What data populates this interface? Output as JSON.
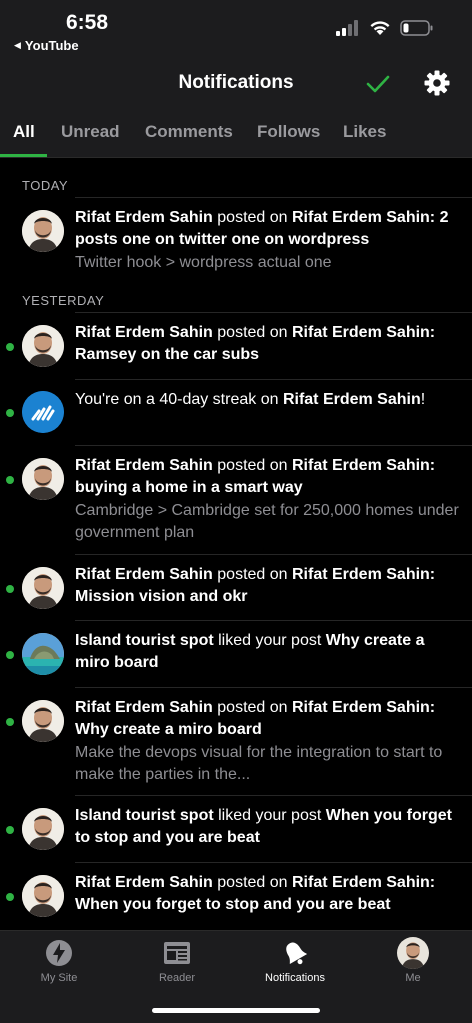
{
  "status_bar": {
    "time": "6:58",
    "back_app": "YouTube"
  },
  "nav": {
    "title": "Notifications",
    "check_color": "#2fb344"
  },
  "tabs": [
    {
      "label": "All",
      "active": true
    },
    {
      "label": "Unread",
      "active": false
    },
    {
      "label": "Comments",
      "active": false
    },
    {
      "label": "Follows",
      "active": false
    },
    {
      "label": "Likes",
      "active": false
    }
  ],
  "sections": {
    "today": "TODAY",
    "yesterday": "YESTERDAY"
  },
  "notifications": [
    {
      "avatar": "person-avatar",
      "unread": false,
      "actor": "Rifat Erdem Sahin",
      "verb": "posted on",
      "target": "Rifat Erdem Sahin:",
      "title": "2 posts one on twitter one on wordpress",
      "excerpt": "Twitter hook > wordpress actual one"
    },
    {
      "avatar": "person-avatar",
      "unread": true,
      "actor": "Rifat Erdem Sahin",
      "verb": "posted on",
      "target": "Rifat Erdem Sahin:",
      "title": "Ramsey on the car subs",
      "excerpt": ""
    },
    {
      "avatar": "streak-avatar",
      "unread": true,
      "text_pre": "You're on a 40-day streak on ",
      "target": "Rifat Erdem Sahin",
      "text_post": "!"
    },
    {
      "avatar": "person-avatar",
      "unread": true,
      "actor": "Rifat Erdem Sahin",
      "verb": "posted on",
      "target": "Rifat Erdem Sahin:",
      "title": "buying a home in a smart way",
      "excerpt": "Cambridge > Cambridge set for 250,000 homes under government plan"
    },
    {
      "avatar": "person-avatar",
      "unread": true,
      "actor": "Rifat Erdem Sahin",
      "verb": "posted on",
      "target": "Rifat Erdem Sahin:",
      "title": "Mission vision and okr",
      "excerpt": ""
    },
    {
      "avatar": "island-avatar",
      "unread": true,
      "actor": "Island tourist spot",
      "verb": "liked your post",
      "target": "Why create a miro board",
      "title": "",
      "excerpt": ""
    },
    {
      "avatar": "person-avatar",
      "unread": true,
      "actor": "Rifat Erdem Sahin",
      "verb": "posted on",
      "target": "Rifat Erdem Sahin:",
      "title": "Why create a miro board",
      "excerpt": "Make the devops visual for the integration to start to make the parties in the..."
    },
    {
      "avatar": "person-avatar",
      "unread": true,
      "actor": "Island tourist spot",
      "verb": "liked your post",
      "target": "When you forget to stop and you are beat",
      "title": "",
      "excerpt": ""
    },
    {
      "avatar": "person-avatar",
      "unread": true,
      "actor": "Rifat Erdem Sahin",
      "verb": "posted on",
      "target": "Rifat Erdem Sahin:",
      "title": "When you forget to stop and you are beat",
      "excerpt": ""
    }
  ],
  "tab_bar": [
    {
      "label": "My Site",
      "icon": "my-site-icon",
      "active": false
    },
    {
      "label": "Reader",
      "icon": "reader-icon",
      "active": false
    },
    {
      "label": "Notifications",
      "icon": "bell-icon",
      "active": true
    },
    {
      "label": "Me",
      "icon": "profile-avatar",
      "active": false
    }
  ],
  "colors": {
    "accent_green": "#2fb344",
    "background": "#000000",
    "bar_background": "#1c1c1e"
  }
}
